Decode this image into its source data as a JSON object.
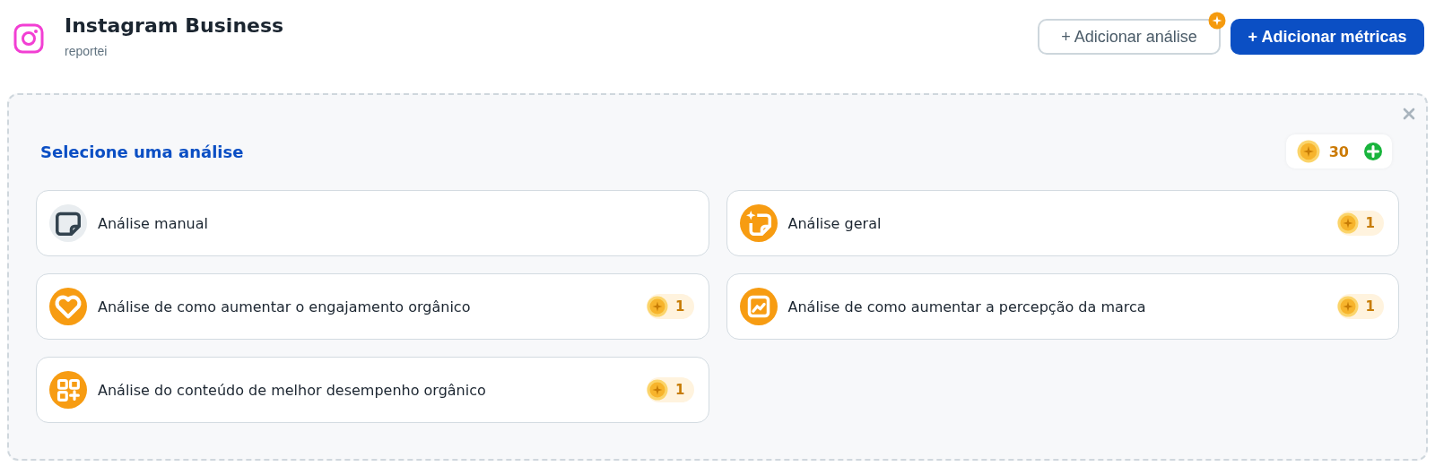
{
  "header": {
    "title": "Instagram Business",
    "subtitle": "reportei"
  },
  "actions": [
    {
      "label": "+ Adicionar análise",
      "kind": "outline",
      "badge": true
    },
    {
      "label": "+ Adicionar métricas",
      "kind": "primary",
      "badge": false
    }
  ],
  "panel": {
    "title": "Selecione uma análise",
    "credits": "30",
    "options": [
      {
        "label": "Análise manual",
        "kind": "note"
      },
      {
        "label": "Análise geral",
        "kind": "sparkle-note",
        "cost": "1"
      },
      {
        "label": "Análise de como aumentar o engajamento orgânico",
        "kind": "heart",
        "cost": "1"
      },
      {
        "label": "Análise de como aumentar a percepção da marca",
        "kind": "chart",
        "cost": "1"
      },
      {
        "label": "Análise do conteúdo de melhor desempenho orgânico",
        "kind": "grid",
        "cost": "1"
      }
    ]
  }
}
